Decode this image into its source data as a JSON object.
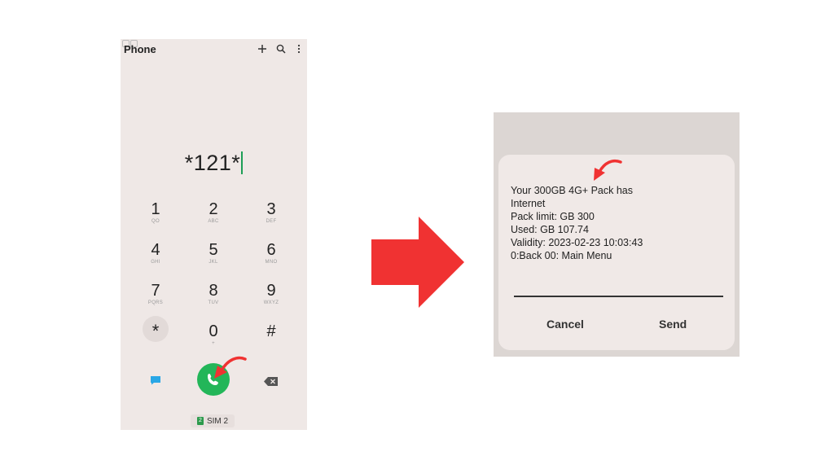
{
  "phone": {
    "title": "Phone",
    "header_icons": [
      "plus-icon",
      "search-icon",
      "more-vert-icon"
    ],
    "dialed_number": "*121*",
    "keypad": [
      {
        "digit": "1",
        "letters": "QO"
      },
      {
        "digit": "2",
        "letters": "ABC"
      },
      {
        "digit": "3",
        "letters": "DEF"
      },
      {
        "digit": "4",
        "letters": "GHI"
      },
      {
        "digit": "5",
        "letters": "JKL"
      },
      {
        "digit": "6",
        "letters": "MNO"
      },
      {
        "digit": "7",
        "letters": "PQRS"
      },
      {
        "digit": "8",
        "letters": "TUV"
      },
      {
        "digit": "9",
        "letters": "WXYZ"
      },
      {
        "digit": "*",
        "letters": ""
      },
      {
        "digit": "0",
        "letters": "+"
      },
      {
        "digit": "#",
        "letters": ""
      }
    ],
    "sim_badge": "2",
    "sim_label": "SIM 2",
    "accent_color": "#23b659"
  },
  "arrow_color": "#f03232",
  "ussd": {
    "lines": [
      "Your 300GB 4G+ Pack has",
      "Internet",
      "Pack limit: GB 300",
      "Used: GB 107.74",
      "Validity: 2023-02-23 10:03:43",
      "0:Back 00: Main Menu"
    ],
    "cancel_label": "Cancel",
    "send_label": "Send"
  }
}
